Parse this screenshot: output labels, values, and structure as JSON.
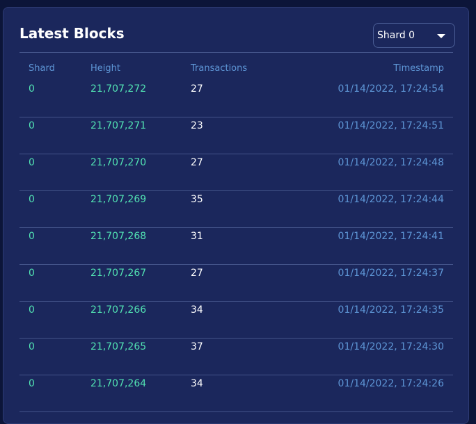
{
  "panel": {
    "title": "Latest Blocks",
    "shard_select": {
      "selected": "Shard 0"
    }
  },
  "table": {
    "columns": {
      "shard": "Shard",
      "height": "Height",
      "transactions": "Transactions",
      "timestamp": "Timestamp"
    },
    "rows": [
      {
        "shard": "0",
        "height": "21,707,272",
        "transactions": "27",
        "timestamp": "01/14/2022, 17:24:54"
      },
      {
        "shard": "0",
        "height": "21,707,271",
        "transactions": "23",
        "timestamp": "01/14/2022, 17:24:51"
      },
      {
        "shard": "0",
        "height": "21,707,270",
        "transactions": "27",
        "timestamp": "01/14/2022, 17:24:48"
      },
      {
        "shard": "0",
        "height": "21,707,269",
        "transactions": "35",
        "timestamp": "01/14/2022, 17:24:44"
      },
      {
        "shard": "0",
        "height": "21,707,268",
        "transactions": "31",
        "timestamp": "01/14/2022, 17:24:41"
      },
      {
        "shard": "0",
        "height": "21,707,267",
        "transactions": "27",
        "timestamp": "01/14/2022, 17:24:37"
      },
      {
        "shard": "0",
        "height": "21,707,266",
        "transactions": "34",
        "timestamp": "01/14/2022, 17:24:35"
      },
      {
        "shard": "0",
        "height": "21,707,265",
        "transactions": "37",
        "timestamp": "01/14/2022, 17:24:30"
      },
      {
        "shard": "0",
        "height": "21,707,264",
        "transactions": "34",
        "timestamp": "01/14/2022, 17:24:26"
      }
    ]
  },
  "colors": {
    "page_background": "#0c1539",
    "panel_background": "#1b275c",
    "accent_green": "#52e3b3",
    "muted_blue": "#5e96d6",
    "divider": "#44548a"
  }
}
